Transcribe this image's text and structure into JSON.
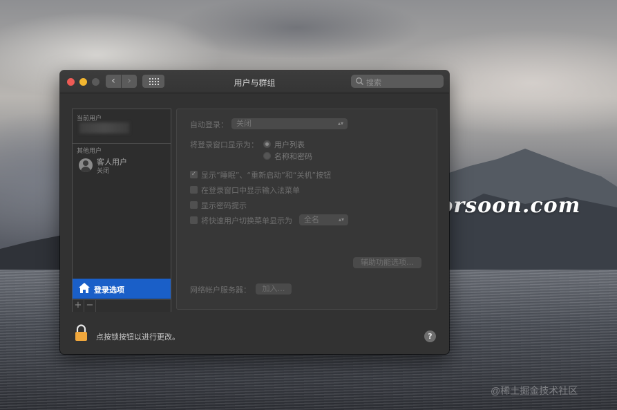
{
  "window": {
    "title": "用户与群组",
    "search_placeholder": "搜索"
  },
  "sidebar": {
    "current_users_label": "当前用户",
    "other_users_label": "其他用户",
    "guest": {
      "name": "客人用户",
      "status": "关闭"
    },
    "login_options_label": "登录选项",
    "add_symbol": "+",
    "remove_symbol": "−"
  },
  "panel": {
    "auto_login_label": "自动登录：",
    "auto_login_value": "关闭",
    "display_login_as_label": "将登录窗口显示为：",
    "radio_options": [
      {
        "label": "用户列表",
        "selected": true
      },
      {
        "label": "名称和密码",
        "selected": false
      }
    ],
    "checkboxes": [
      {
        "label": "显示“睡眠”、“重新启动”和“关机”按钮",
        "checked": true
      },
      {
        "label": "在登录窗口中显示输入法菜单",
        "checked": false
      },
      {
        "label": "显示密码提示",
        "checked": false
      },
      {
        "label": "将快速用户切换菜单显示为",
        "checked": false
      }
    ],
    "fast_switch_value": "全名",
    "accessibility_button": "辅助功能选项…",
    "network_server_label": "网络帐户服务器：",
    "join_button": "加入…"
  },
  "footer": {
    "lock_text": "点按锁按钮以进行更改。",
    "help_symbol": "?"
  },
  "desktop": {
    "watermark": "Mac.orsoon.com",
    "credit": "@稀土掘金技术社区"
  },
  "colors": {
    "selection": "#1a5fc8",
    "close": "#ee5b55",
    "minimize": "#f2b630",
    "lock": "#f0a73c"
  }
}
